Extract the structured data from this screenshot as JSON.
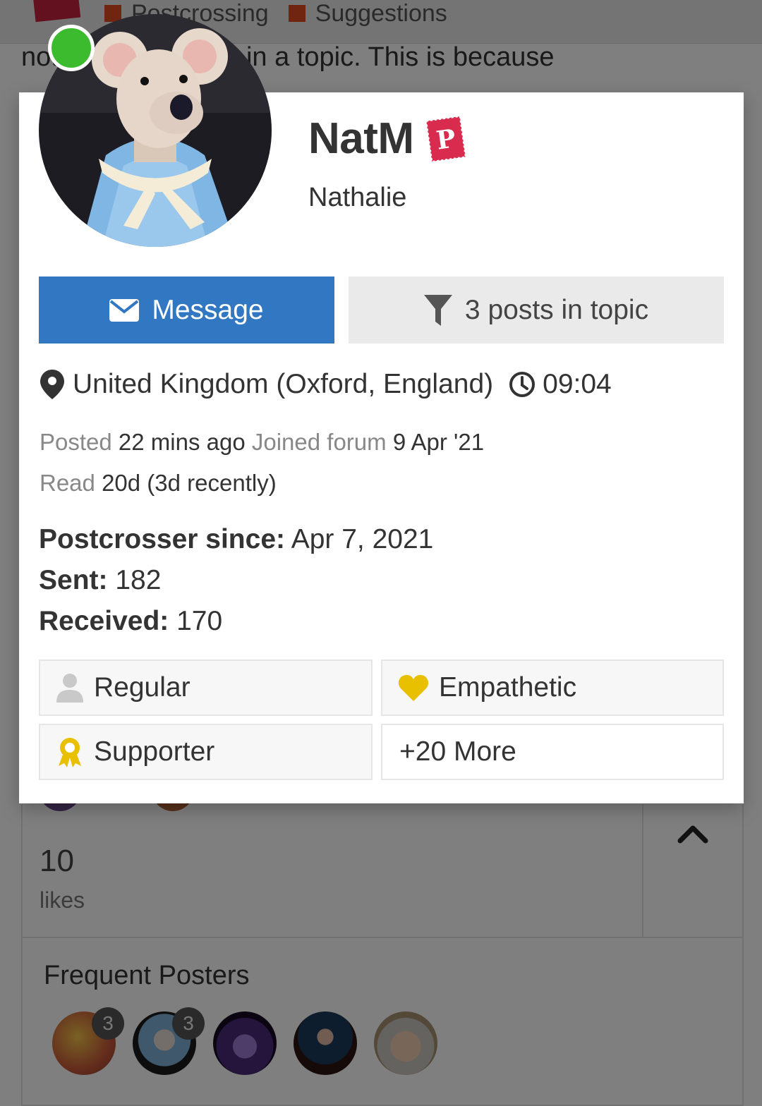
{
  "background": {
    "categories": [
      "Postcrossing",
      "Suggestions"
    ],
    "post_text": "not post only once in a topic. This is because",
    "likes_count": "10",
    "likes_label": "likes",
    "frequent_posters_title": "Frequent Posters",
    "poster_counts": [
      "3",
      "3"
    ]
  },
  "card": {
    "username": "NatM",
    "full_name": "Nathalie",
    "message_button": "Message",
    "posts_in_topic_button": "3 posts in topic",
    "location": "United Kingdom (Oxford, England)",
    "local_time": "09:04",
    "posted_label": "Posted",
    "posted_value": "22 mins ago",
    "joined_label": "Joined forum",
    "joined_value": "9 Apr '21",
    "read_label": "Read",
    "read_value": "20d (3d recently)",
    "postcrosser_since_label": "Postcrosser since:",
    "postcrosser_since_value": "Apr 7, 2021",
    "sent_label": "Sent:",
    "sent_value": "182",
    "received_label": "Received:",
    "received_value": "170",
    "badges": [
      {
        "label": "Regular",
        "icon": "user-icon"
      },
      {
        "label": "Empathetic",
        "icon": "heart-icon"
      },
      {
        "label": "Supporter",
        "icon": "award-icon"
      },
      {
        "label": "+20 More",
        "icon": ""
      }
    ]
  },
  "colors": {
    "primary": "#3177c2",
    "online": "#3dbb2f",
    "brand": "#c8233f",
    "badge_gold": "#e8c000"
  }
}
